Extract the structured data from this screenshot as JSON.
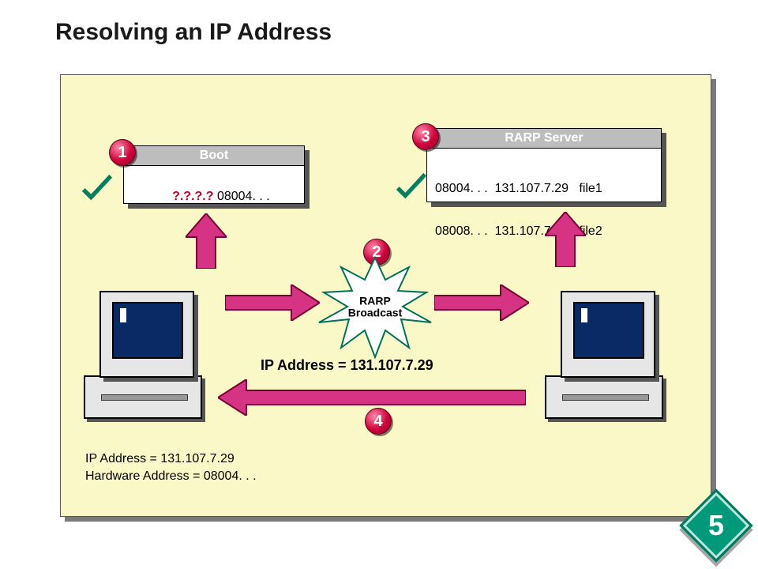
{
  "title": "Resolving an IP Address",
  "boot_panel": {
    "heading": "Boot",
    "body_q": "?.?.?.?",
    "body_rest": " 08004. . ."
  },
  "rarp_panel": {
    "heading": "RARP Server",
    "row1": "08004. . .  131.107.7.29   file1",
    "row2": "08008. . .  131.107.7.28   file2"
  },
  "steps": {
    "s1": "1",
    "s2": "2",
    "s3": "3",
    "s4": "4"
  },
  "broadcast": {
    "line1": "RARP",
    "line2": "Broadcast"
  },
  "ip_reply": "IP Address = 131.107.7.29",
  "client_info": {
    "line1": "IP Address =  131.107.7.29",
    "line2": "Hardware Address = 08004. . ."
  },
  "slide_number": "5"
}
